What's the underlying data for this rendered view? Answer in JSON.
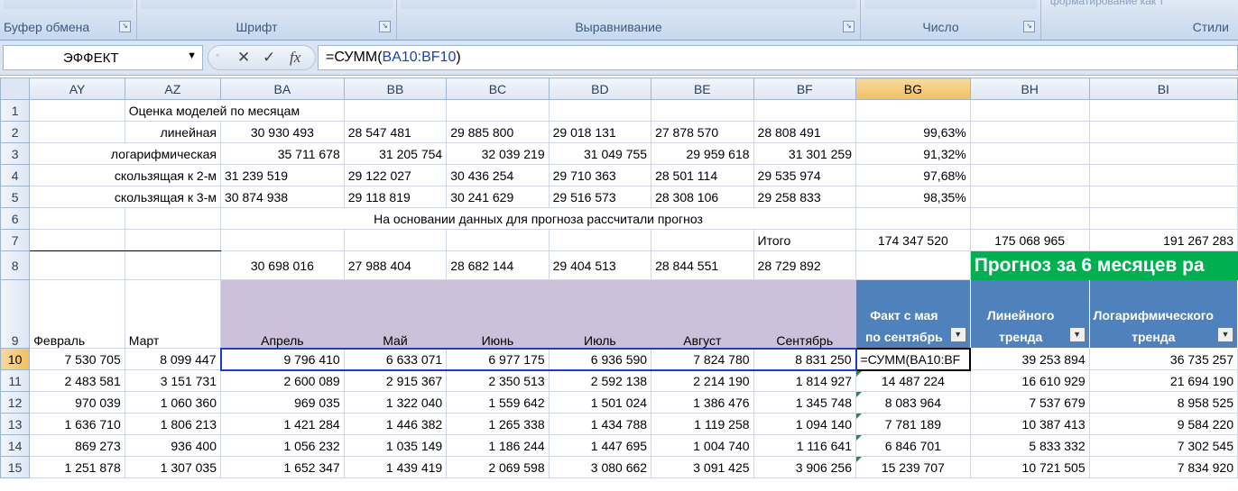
{
  "ribbon": {
    "groups": [
      {
        "label": "Буфер обмена",
        "launcher": "↘"
      },
      {
        "label": "Шрифт",
        "launcher": "↘"
      },
      {
        "label": "Выравнивание",
        "launcher": "↘"
      },
      {
        "label": "Число",
        "launcher": "↘"
      },
      {
        "label": "Стили",
        "ghost": "форматирование    как т"
      }
    ]
  },
  "formula_bar": {
    "name_box": "ЭФФЕКТ",
    "cancel_icon": "✕",
    "enter_icon": "✓",
    "fx_label": "fx",
    "formula_prefix": "=СУММ(",
    "formula_ref": "BA10:BF10",
    "formula_suffix": ")"
  },
  "columns": [
    "AY",
    "AZ",
    "BA",
    "BB",
    "BC",
    "BD",
    "BE",
    "BF",
    "BG",
    "BH",
    "BI"
  ],
  "rows": {
    "r1": {
      "num": "1",
      "title": "Оценка моделей по месяцам"
    },
    "r2": {
      "num": "2",
      "label": "линейная",
      "vals": [
        "30 930 493",
        "28 547 481",
        "29 885 800",
        "29 018 131",
        "27 878 570",
        "28 808 491"
      ],
      "pct": "99,63%"
    },
    "r3": {
      "num": "3",
      "label": "логарифмическая",
      "vals": [
        "35 711 678",
        "31 205 754",
        "32 039 219",
        "31 049 755",
        "29 959 618",
        "31 301 259"
      ],
      "pct": "91,32%"
    },
    "r4": {
      "num": "4",
      "label": "скользящая к 2-м",
      "vals": [
        "31 239 519",
        "29 122 027",
        "30 436 254",
        "29 710 363",
        "28 501 114",
        "29 535 974"
      ],
      "pct": "97,68%"
    },
    "r5": {
      "num": "5",
      "label": "скользящая к 3-м",
      "vals": [
        "30 874 938",
        "29 118 819",
        "30 241 629",
        "29 516 573",
        "28 308 106",
        "29 258 833"
      ],
      "pct": "98,35%"
    },
    "r6": {
      "num": "6",
      "text": "На основании данных для прогноза рассчитали прогноз"
    },
    "r7": {
      "num": "7",
      "label": "Итого",
      "bg": "174 347 520",
      "bh": "175 068 965",
      "bi": "191 267 283"
    },
    "r8": {
      "num": "8",
      "vals": [
        "30 698 016",
        "27 988 404",
        "28 682 144",
        "29 404 513",
        "28 844 551",
        "28 729 892"
      ],
      "banner": "Прогноз за 6 месяцев ра"
    },
    "r9": {
      "num": "9",
      "months": [
        "Февраль",
        "Март",
        "Апрель",
        "Май",
        "Июнь",
        "Июль",
        "Август",
        "Сентябрь"
      ],
      "h1": "Факт с мая по сентябрь",
      "h2": "Линейного тренда",
      "h3": "Логарифмического тренда",
      "filter_icon": "▼"
    },
    "data": [
      {
        "num": "10",
        "vals": [
          "7 530 705",
          "8 099 447",
          "9 796 410",
          "6 633 071",
          "6 977 175",
          "6 936 590",
          "7 824 780",
          "8 831 250",
          "=СУММ(BA10:BF",
          "39 253 894",
          "36 735 257"
        ]
      },
      {
        "num": "11",
        "vals": [
          "2 483 581",
          "3 151 731",
          "2 600 089",
          "2 915 367",
          "2 350 513",
          "2 592 138",
          "2 214 190",
          "1 814 927",
          "14 487 224",
          "16 610 929",
          "21 694 190"
        ]
      },
      {
        "num": "12",
        "vals": [
          "970 039",
          "1 060 360",
          "969 035",
          "1 322 040",
          "1 559 642",
          "1 501 024",
          "1 386 476",
          "1 345 748",
          "8 083 964",
          "7 537 679",
          "8 958 525"
        ]
      },
      {
        "num": "13",
        "vals": [
          "1 636 710",
          "1 806 213",
          "1 421 284",
          "1 446 382",
          "1 265 338",
          "1 434 788",
          "1 119 258",
          "1 094 140",
          "7 781 189",
          "10 387 413",
          "9 584 220"
        ]
      },
      {
        "num": "14",
        "vals": [
          "869 273",
          "936 400",
          "1 056 232",
          "1 035 149",
          "1 186 244",
          "1 447 695",
          "1 004 740",
          "1 116 641",
          "6 846 701",
          "5 833 332",
          "7 302 545"
        ]
      },
      {
        "num": "15",
        "vals": [
          "1 251 878",
          "1 307 035",
          "1 652 347",
          "1 439 419",
          "2 069 598",
          "3 080 662",
          "3 091 425",
          "3 906 256",
          "15 239 707",
          "10 721 505",
          "7 834 920"
        ]
      }
    ]
  },
  "colors": {
    "header_selected": "#f1c15f",
    "table_header_blue": "#4f81bd",
    "month_header_purple": "#ccc0da",
    "banner_green": "#00b050"
  }
}
